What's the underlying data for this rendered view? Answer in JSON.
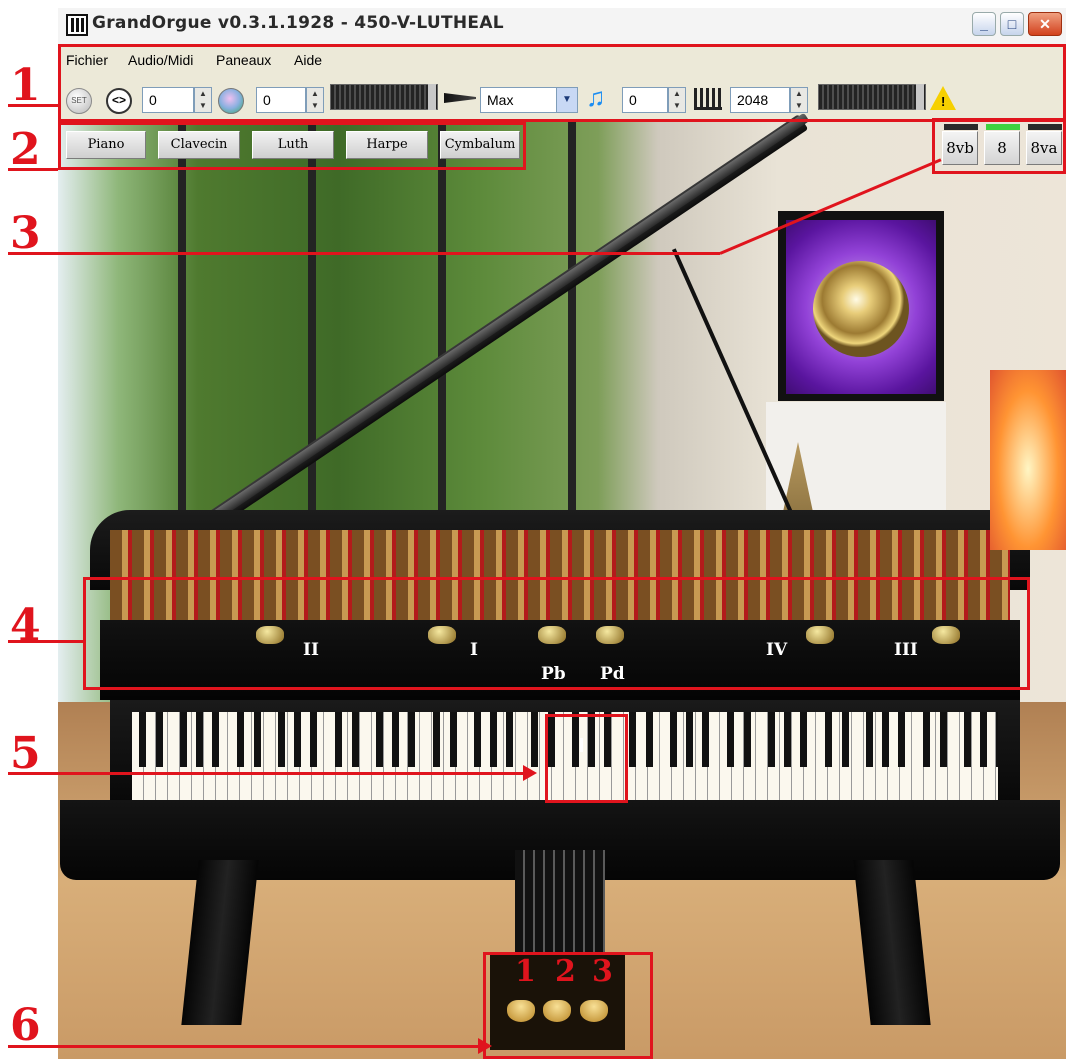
{
  "window": {
    "title": "GrandOrgue v0.3.1.1928 - 450-V-LUTHEAL",
    "icon": "organ-pipes-icon"
  },
  "menu": {
    "items": [
      "Fichier",
      "Audio/Midi",
      "Paneaux",
      "Aide"
    ]
  },
  "toolbar": {
    "set_label": "SET",
    "memory_value": "0",
    "transpose_value": "0",
    "polyphony_select": "Max",
    "tuning_value": "0",
    "release_value": "2048",
    "warning_icon": "warning-icon",
    "colors": {
      "warning": "#f6d000",
      "note_icon": "#1b8df2"
    }
  },
  "stops": [
    "Piano",
    "Clavecin",
    "Luth",
    "Harpe",
    "Cymbalum"
  ],
  "octave_buttons": [
    "8vb",
    "8",
    "8va"
  ],
  "octave_indicator_colors": [
    "#2a2a2a",
    "#3fd23f",
    "#2a2a2a"
  ],
  "knobs": [
    "II",
    "I",
    "Pb",
    "Pd",
    "IV",
    "III"
  ],
  "annotations": {
    "numbers": [
      "1",
      "2",
      "3",
      "4",
      "5",
      "6"
    ],
    "pedal_numbers": [
      "1",
      "2",
      "3"
    ],
    "color": "#e0141d"
  }
}
